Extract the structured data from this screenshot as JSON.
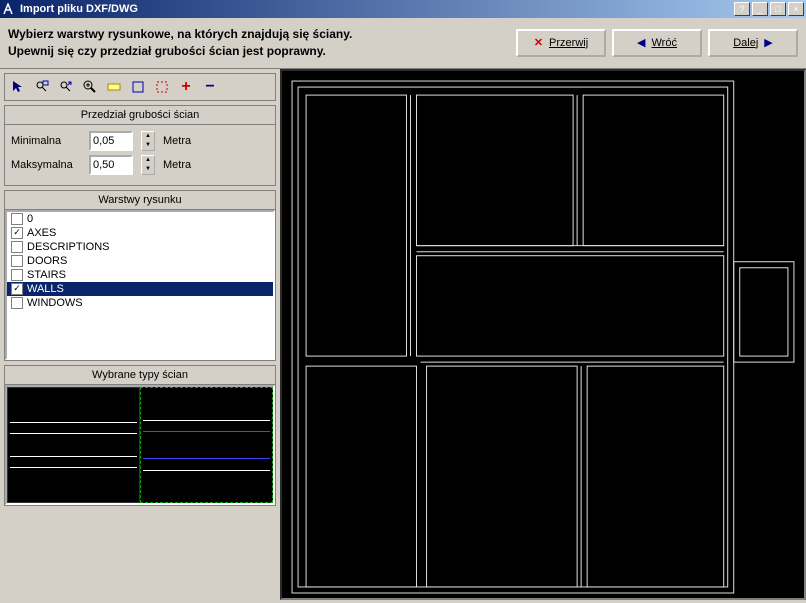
{
  "window": {
    "title": "Import pliku DXF/DWG"
  },
  "header": {
    "line1": "Wybierz warstwy rysunkowe, na których znajdują się ściany.",
    "line2": "Upewnij się czy przedział grubości ścian jest poprawny.",
    "buttons": {
      "cancel": "Przerwij",
      "back": "Wróć",
      "next": "Dalej"
    }
  },
  "thickness": {
    "title": "Przedział grubości ścian",
    "min_label": "Minimalna",
    "min_value": "0,05",
    "min_unit": "Metra",
    "max_label": "Maksymalna",
    "max_value": "0,50",
    "max_unit": "Metra"
  },
  "layers": {
    "title": "Warstwy rysunku",
    "items": [
      {
        "name": "0",
        "checked": false,
        "selected": false
      },
      {
        "name": "AXES",
        "checked": true,
        "selected": false
      },
      {
        "name": "DESCRIPTIONS",
        "checked": false,
        "selected": false
      },
      {
        "name": "DOORS",
        "checked": false,
        "selected": false
      },
      {
        "name": "STAIRS",
        "checked": false,
        "selected": false
      },
      {
        "name": "WALLS",
        "checked": true,
        "selected": true
      },
      {
        "name": "WINDOWS",
        "checked": false,
        "selected": false
      }
    ]
  },
  "wall_types": {
    "title": "Wybrane typy ścian"
  },
  "toolbar_icons": [
    "pointer",
    "zoom-window",
    "zoom-extents",
    "zoom-in",
    "pan-hand",
    "select-box",
    "select-marquee",
    "plus",
    "minus"
  ]
}
